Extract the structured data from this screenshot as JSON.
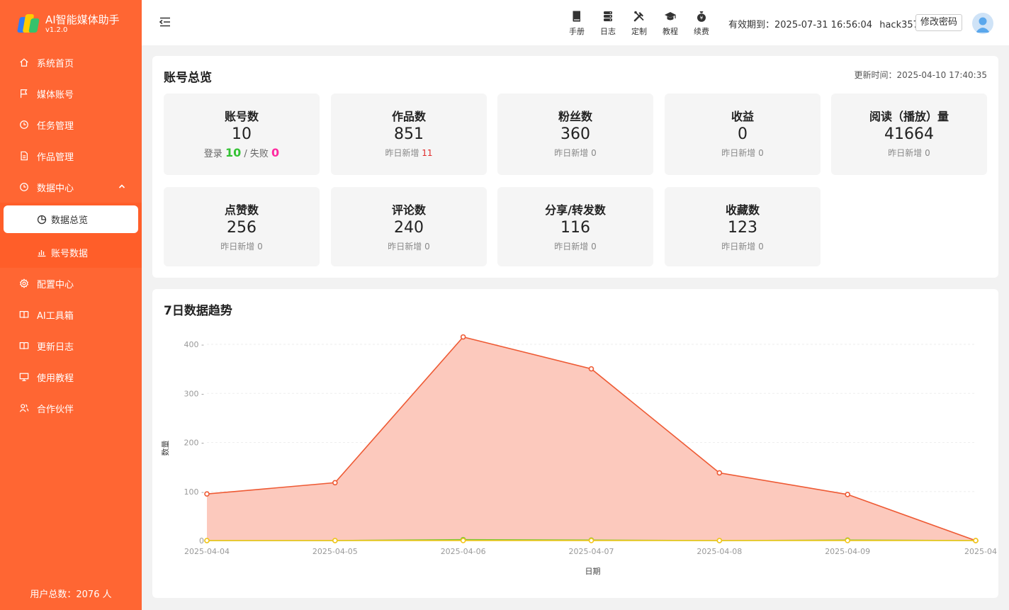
{
  "app": {
    "name": "AI智能媒体助手",
    "version": "v1.2.0"
  },
  "sidebar": {
    "items": [
      {
        "label": "系统首页"
      },
      {
        "label": "媒体账号"
      },
      {
        "label": "任务管理"
      },
      {
        "label": "作品管理"
      },
      {
        "label": "数据中心"
      },
      {
        "label": "配置中心"
      },
      {
        "label": "AI工具箱"
      },
      {
        "label": "更新日志"
      },
      {
        "label": "使用教程"
      },
      {
        "label": "合作伙伴"
      }
    ],
    "submenu": [
      {
        "label": "数据总览"
      },
      {
        "label": "账号数据"
      }
    ],
    "footer": "用户总数：2076 人"
  },
  "header": {
    "tools": [
      {
        "label": "手册"
      },
      {
        "label": "日志"
      },
      {
        "label": "定制"
      },
      {
        "label": "教程"
      },
      {
        "label": "续费"
      }
    ],
    "expire": "有效期到：2025-07-31 16:56:04",
    "username": "hack357",
    "change_password": "修改密码"
  },
  "overview": {
    "title": "账号总览",
    "update_time": "更新时间：2025-04-10 17:40:35",
    "accounts": {
      "label": "账号数",
      "value": "10",
      "login_label": "登录",
      "login_value": "10",
      "sep": "/",
      "fail_label": "失败",
      "fail_value": "0"
    },
    "stats": [
      {
        "label": "作品数",
        "value": "851",
        "sub_label": "昨日新增",
        "sub_value": "11"
      },
      {
        "label": "粉丝数",
        "value": "360",
        "sub_label": "昨日新增",
        "sub_value": "0"
      },
      {
        "label": "收益",
        "value": "0",
        "sub_label": "昨日新增",
        "sub_value": "0"
      },
      {
        "label": "阅读（播放）量",
        "value": "41664",
        "sub_label": "昨日新增",
        "sub_value": "0"
      },
      {
        "label": "点赞数",
        "value": "256",
        "sub_label": "昨日新增",
        "sub_value": "0"
      },
      {
        "label": "评论数",
        "value": "240",
        "sub_label": "昨日新增",
        "sub_value": "0"
      },
      {
        "label": "分享/转发数",
        "value": "116",
        "sub_label": "昨日新增",
        "sub_value": "0"
      },
      {
        "label": "收藏数",
        "value": "123",
        "sub_label": "昨日新增",
        "sub_value": "0"
      }
    ]
  },
  "trend": {
    "title": "7日数据趋势"
  },
  "chart_data": {
    "type": "area",
    "title": "7日数据趋势",
    "xlabel": "日期",
    "ylabel": "数量",
    "ylim": [
      0,
      400
    ],
    "yticks": [
      0,
      100,
      200,
      300,
      400
    ],
    "grid": true,
    "categories": [
      "2025-04-04",
      "2025-04-05",
      "2025-04-06",
      "2025-04-07",
      "2025-04-08",
      "2025-04-09",
      "2025-04"
    ],
    "series": [
      {
        "values": [
          95,
          118,
          415,
          350,
          138,
          94,
          0
        ],
        "color": "#ee5a34",
        "fill": "#fcc9bd"
      },
      {
        "values": [
          0,
          0,
          2,
          1,
          0,
          1,
          0
        ],
        "color": "#7cc63a"
      },
      {
        "values": [
          0,
          0,
          0,
          0,
          0,
          0,
          0
        ],
        "color": "#f5c518"
      }
    ]
  },
  "colors": {
    "sidebar": "#ff6633",
    "accent": "#ee5a34",
    "success": "#34c234",
    "fail": "#ff2aa0",
    "new": "#e02a2a"
  }
}
